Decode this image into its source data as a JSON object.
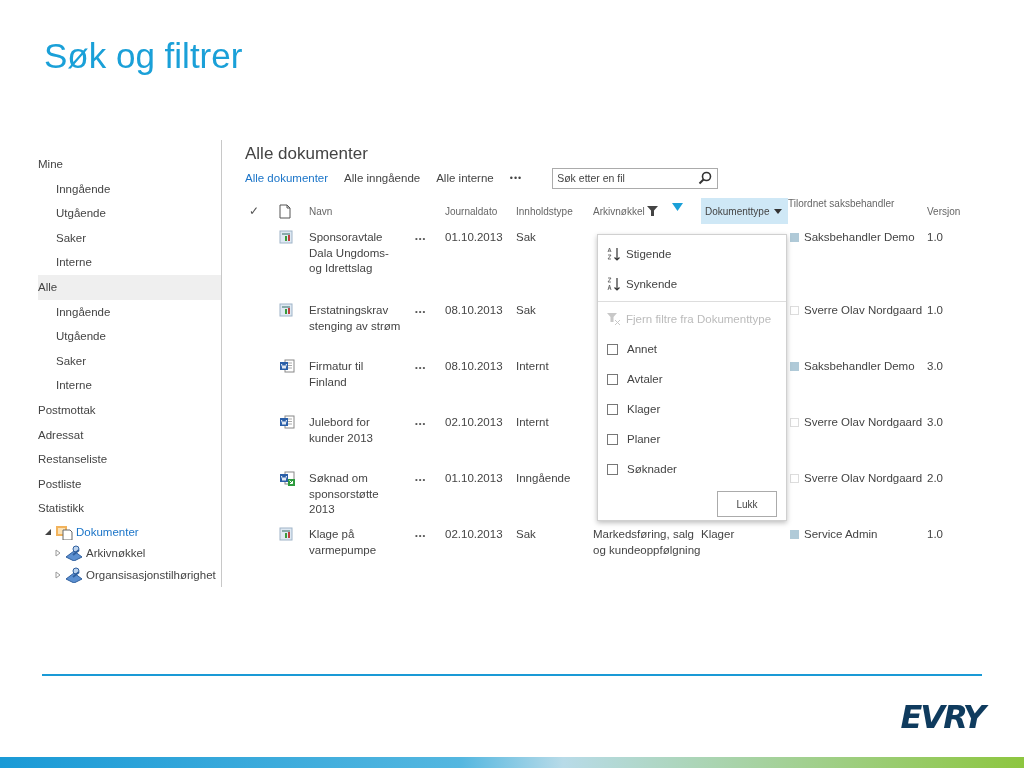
{
  "slide": {
    "title": "Søk og filtrer",
    "logo": "EVRY"
  },
  "sidebar": {
    "items": [
      {
        "label": "Mine",
        "selected": false,
        "children": [
          {
            "label": "Inngående",
            "selected": false
          },
          {
            "label": "Utgående",
            "selected": false
          },
          {
            "label": "Saker",
            "selected": false
          },
          {
            "label": "Interne",
            "selected": false
          }
        ]
      },
      {
        "label": "Alle",
        "selected": true,
        "children": [
          {
            "label": "Inngående",
            "selected": false
          },
          {
            "label": "Utgående",
            "selected": false
          },
          {
            "label": "Saker",
            "selected": false
          },
          {
            "label": "Interne",
            "selected": false
          }
        ]
      },
      {
        "label": "Postmottak",
        "selected": false
      },
      {
        "label": "Adressat",
        "selected": false
      },
      {
        "label": "Restanseliste",
        "selected": false
      },
      {
        "label": "Postliste",
        "selected": false
      },
      {
        "label": "Statistikk",
        "selected": false
      }
    ],
    "tree": [
      {
        "label": "Dokumenter",
        "kind": "library",
        "expanded": true,
        "children": [
          {
            "label": "Arkivnøkkel",
            "kind": "metadata",
            "expanded": false
          },
          {
            "label": "Organsisasjonstilhørighet",
            "kind": "metadata",
            "expanded": false
          }
        ]
      }
    ]
  },
  "view": {
    "title": "Alle dokumenter",
    "views": [
      {
        "label": "Alle dokumenter",
        "selected": true
      },
      {
        "label": "Alle inngående",
        "selected": false
      },
      {
        "label": "Alle interne",
        "selected": false
      }
    ],
    "more": "•••",
    "search": {
      "placeholder": "Søk etter en fil"
    }
  },
  "table": {
    "select_all": "✓",
    "columns": [
      {
        "label": "Navn",
        "filtered": false,
        "selected": false
      },
      {
        "label": "Journaldato",
        "filtered": false,
        "selected": false
      },
      {
        "label": "Innholdstype",
        "filtered": false,
        "selected": false
      },
      {
        "label": "Arkivnøkkel",
        "filtered": true,
        "selected": false
      },
      {
        "label": "Dokumenttype",
        "filtered": false,
        "selected": true
      },
      {
        "label": "Tilordnet saksbehandler",
        "filtered": false,
        "selected": false
      },
      {
        "label": "Versjon",
        "filtered": false,
        "selected": false
      }
    ],
    "rows": [
      {
        "kind": "page",
        "name": "Sponsoravtale Dala Ungdoms- og Idrettslag",
        "more": "•••",
        "date": "01.10.2013",
        "content_type": "Sak",
        "assignee": "Saksbehandler Demo",
        "online": true,
        "version": "1.0"
      },
      {
        "kind": "page",
        "name": "Erstatningskrav stenging av strøm",
        "more": "•••",
        "date": "08.10.2013",
        "content_type": "Sak",
        "assignee": "Sverre Olav Nordgaard",
        "online": false,
        "version": "1.0"
      },
      {
        "kind": "word",
        "name": "Firmatur til Finland",
        "more": "•••",
        "date": "08.10.2013",
        "content_type": "Internt",
        "assignee": "Saksbehandler Demo",
        "online": true,
        "version": "3.0"
      },
      {
        "kind": "word",
        "name": "Julebord for kunder 2013",
        "more": "•••",
        "date": "02.10.2013",
        "content_type": "Internt",
        "assignee": "Sverre Olav Nordgaard",
        "online": false,
        "version": "3.0"
      },
      {
        "kind": "incoming",
        "name": "Søknad om sponsorstøtte 2013",
        "more": "•••",
        "date": "01.10.2013",
        "content_type": "Inngående",
        "assignee": "Sverre Olav Nordgaard",
        "online": false,
        "version": "2.0"
      },
      {
        "kind": "page",
        "name": "Klage på varmepumpe",
        "more": "•••",
        "date": "02.10.2013",
        "content_type": "Sak",
        "archive_key": "Markedsføring, salg og kundeoppfølgning",
        "document_type": "Klager",
        "assignee": "Service Admin",
        "online": true,
        "version": "1.0"
      }
    ]
  },
  "dropdown": {
    "sort": [
      {
        "label": "Stigende",
        "kind": "asc"
      },
      {
        "label": "Synkende",
        "kind": "desc"
      }
    ],
    "clear": {
      "label": "Fjern filtre fra Dokumenttype",
      "disabled": true
    },
    "options": [
      {
        "label": "Annet",
        "checked": false
      },
      {
        "label": "Avtaler",
        "checked": false
      },
      {
        "label": "Klager",
        "checked": false
      },
      {
        "label": "Planer",
        "checked": false
      },
      {
        "label": "Søknader",
        "checked": false
      }
    ],
    "close": "Lukk"
  }
}
